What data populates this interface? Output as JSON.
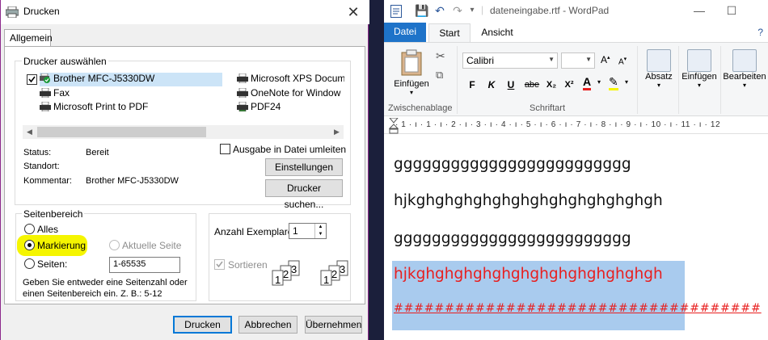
{
  "dialog": {
    "title": "Drucken",
    "tab": "Allgemein",
    "printer_group_label": "Drucker auswählen",
    "printers": [
      {
        "name": "Brother MFC-J5330DW",
        "icon": "printer-default-icon",
        "selected": true
      },
      {
        "name": "Fax",
        "icon": "fax-icon",
        "selected": false
      },
      {
        "name": "Microsoft Print to PDF",
        "icon": "printer-icon",
        "selected": false
      },
      {
        "name": "Microsoft XPS Docum",
        "icon": "printer-icon",
        "selected": false
      },
      {
        "name": "OneNote for Window",
        "icon": "printer-icon",
        "selected": false
      },
      {
        "name": "PDF24",
        "icon": "printer-icon",
        "selected": false
      }
    ],
    "status_label": "Status:",
    "status_value": "Bereit",
    "location_label": "Standort:",
    "location_value": "",
    "comment_label": "Kommentar:",
    "comment_value": "Brother MFC-J5330DW",
    "print_to_file_label": "Ausgabe in Datei umleiten",
    "settings_button": "Einstellungen",
    "find_printer_button": "Drucker suchen...",
    "page_range_group_label": "Seitenbereich",
    "range_all": "Alles",
    "range_selection": "Markierung",
    "range_current_page": "Aktuelle Seite",
    "range_pages": "Seiten:",
    "range_pages_value": "1-65535",
    "range_hint": "Geben Sie entweder eine Seitenzahl oder einen Seitenbereich ein.  Z. B.: 5-12",
    "copies_label": "Anzahl Exemplare:",
    "copies_value": "1",
    "collate_label": "Sortieren",
    "collate_digits": [
      "1",
      "2",
      "3"
    ],
    "print_button": "Drucken",
    "cancel_button": "Abbrechen",
    "apply_button": "Übernehmen"
  },
  "wordpad": {
    "title": "dateneingabe.rtf - WordPad",
    "tabs": [
      "Datei",
      "Start",
      "Ansicht"
    ],
    "paste_label": "Einfügen",
    "clipboard_label": "Zwischenablage",
    "font_name": "Calibri",
    "font_size": "",
    "font_group_label": "Schriftart",
    "format_buttons": [
      "F",
      "K",
      "U",
      "abe",
      "X₂",
      "X²"
    ],
    "paragraph_label": "Absatz",
    "insert_label": "Einfügen",
    "edit_label": "Bearbeiten",
    "ruler": "· 1 · ı · 1 · ı · 2 · ı · 3 · ı · 4 · ı · 5 · ı · 6 · ı · 7 · ı · 8 · ı · 9 · ı · 10 · ı · 11 · ı · 12",
    "lines": [
      "ggggggggggggggggggggggggg",
      "hjkghghghghghghghghghghghghgh",
      "ggggggggggggggggggggggggg",
      "hjkghghghghghghghghghghghghgh",
      "####################################"
    ],
    "text_color": "#e81e1e",
    "selection_color": "#a9cbee"
  }
}
